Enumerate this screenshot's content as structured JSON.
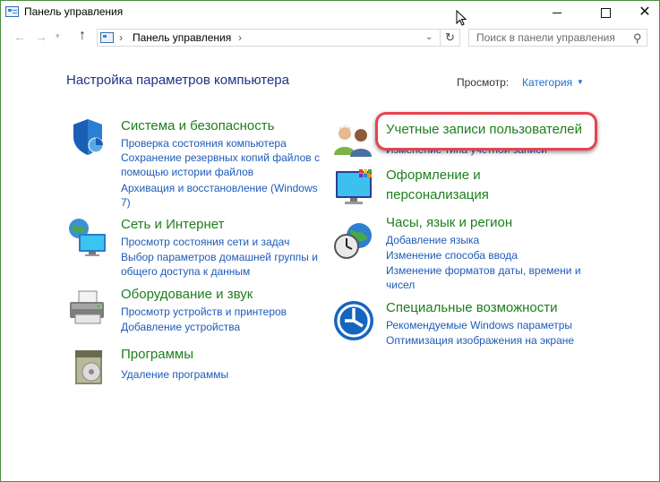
{
  "window": {
    "title": "Панель управления"
  },
  "window_controls": {
    "minimize": "—",
    "maximize": "☐",
    "close": "✕"
  },
  "nav": {
    "back": "←",
    "forward": "→",
    "recent": "▾",
    "up": "↑",
    "address_sep": "›",
    "address": "Панель управления",
    "address_sep2": "›",
    "address_dropdown": "⌄",
    "refresh": "↻",
    "search_placeholder": "Поиск в панели управления",
    "search_value": "",
    "search_icon": "⚲"
  },
  "header": {
    "title": "Настройка параметров компьютера",
    "view_label": "Просмотр:",
    "view_value": "Категория",
    "view_caret": "▼"
  },
  "categories_left": [
    {
      "icon": "shield-icon",
      "title": "Система и безопасность",
      "links": [
        "Проверка состояния компьютера",
        "Сохранение резервных копий файлов с",
        "помощью истории файлов",
        "Архивация и восстановление (Windows",
        "7)"
      ]
    },
    {
      "icon": "network-globe-icon",
      "title": "Сеть и Интернет",
      "links": [
        "Просмотр состояния сети и задач",
        "Выбор параметров домашней группы и",
        "общего доступа к данным"
      ]
    },
    {
      "icon": "printer-icon",
      "title": "Оборудование и звук",
      "links": [
        "Просмотр устройств и принтеров",
        "Добавление устройства"
      ]
    },
    {
      "icon": "programs-icon",
      "title": "Программы",
      "links": [
        "Удаление программы"
      ]
    }
  ],
  "categories_right": [
    {
      "icon": "users-icon",
      "title": "Учетные записи пользователей",
      "links": [
        "Изменение типа учетной записи"
      ]
    },
    {
      "icon": "appearance-icon",
      "title_lines": [
        "Оформление и",
        "персонализация"
      ],
      "links": []
    },
    {
      "icon": "clock-globe-icon",
      "title": "Часы, язык и регион",
      "links": [
        "Добавление языка",
        "Изменение способа ввода",
        "Изменение форматов даты, времени и",
        "чисел"
      ]
    },
    {
      "icon": "accessibility-icon",
      "title": "Специальные возможности",
      "links": [
        "Рекомендуемые Windows параметры",
        "Оптимизация изображения на экране"
      ]
    }
  ],
  "colors": {
    "title_blue": "#1e3287",
    "category_green": "#1d7f1d",
    "link_blue": "#1e5bb8",
    "highlight_red": "#e8434d"
  }
}
